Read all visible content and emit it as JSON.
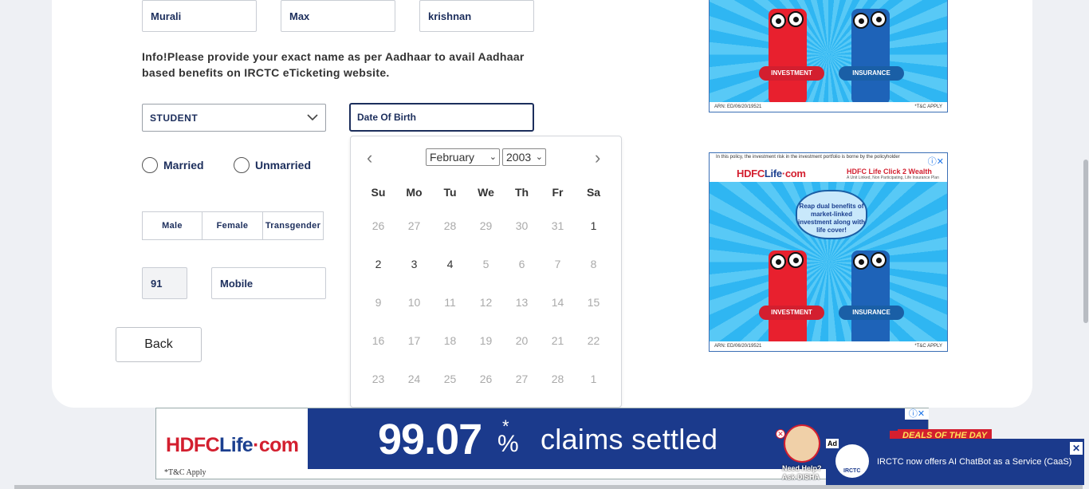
{
  "form": {
    "first_name": "Murali",
    "middle_name": "Max",
    "last_name": "krishnan",
    "info_text": "Info!Please provide your exact name as per Aadhaar to avail Aadhaar based benefits on IRCTC eTicketing website.",
    "occupation": "STUDENT",
    "dob_placeholder": "Date Of Birth",
    "marital": [
      "Married",
      "Unmarried"
    ],
    "gender": [
      "Male",
      "Female",
      "Transgender"
    ],
    "country_code": "91",
    "mobile_placeholder": "Mobile",
    "back_label": "Back"
  },
  "calendar": {
    "month": "February",
    "year": "2003",
    "weekdays": [
      "Su",
      "Mo",
      "Tu",
      "We",
      "Th",
      "Fr",
      "Sa"
    ],
    "weeks": [
      [
        "26",
        "27",
        "28",
        "29",
        "30",
        "31",
        "1"
      ],
      [
        "2",
        "3",
        "4",
        "5",
        "6",
        "7",
        "8"
      ],
      [
        "9",
        "10",
        "11",
        "12",
        "13",
        "14",
        "15"
      ],
      [
        "16",
        "17",
        "18",
        "19",
        "20",
        "21",
        "22"
      ],
      [
        "23",
        "24",
        "25",
        "26",
        "27",
        "28",
        "1"
      ]
    ]
  },
  "ads": {
    "side_top": {
      "investment": "INVESTMENT",
      "insurance": "INSURANCE",
      "arn": "ARN: ED/06/20/19521",
      "tc": "*T&C APPLY"
    },
    "side_bottom": {
      "disclaimer": "In this policy, the investment risk in the investment portfolio is borne by the policyholder",
      "logo_a": "HDFC",
      "logo_b": "Life",
      "logo_c": "·com",
      "product": "HDFC Life Click 2 Wealth",
      "product_sub": "A Unit Linked, Non Participating, Life Insurance Plan",
      "cloud": "Reap dual benefits of market-linked investment along with life cover!",
      "investment": "INVESTMENT",
      "insurance": "INSURANCE",
      "arn": "ARN: ED/06/20/19521",
      "tc": "*T&C APPLY"
    },
    "banner": {
      "logo_a": "HDFC",
      "logo_b": "Life",
      "logo_c": "·com",
      "tc": "*T&C Apply",
      "number": "99.07",
      "star": "*",
      "pct": "%",
      "claims": "claims settled"
    },
    "deals": "DEALS OF THE DAY",
    "disha": "Need Help? Ask DISHA",
    "irctc": {
      "ad_tag": "Ad",
      "logo": "IRCTC",
      "message": "IRCTC now offers AI ChatBot as a Service (CaaS)"
    }
  }
}
